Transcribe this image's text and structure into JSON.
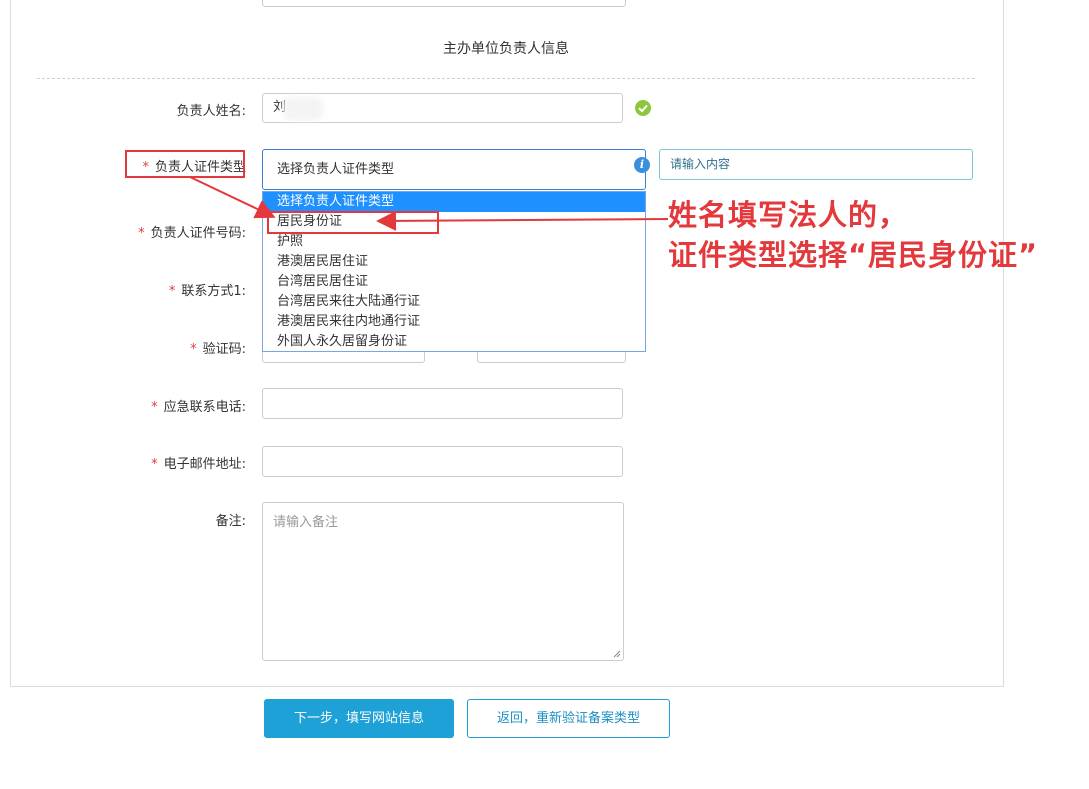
{
  "section": {
    "title": "主办单位负责人信息"
  },
  "form": {
    "name_label": "负责人姓名:",
    "name_value": "刘",
    "idtype_label": "负责人证件类型",
    "idtype_value": "选择负责人证件类型",
    "idtype_tooltip": "请输入内容",
    "idnum_label": "负责人证件号码:",
    "contact_label": "联系方式1:",
    "captcha_label": "验证码:",
    "emergency_label": "应急联系电话:",
    "email_label": "电子邮件地址:",
    "remark_label": "备注:",
    "remark_placeholder": "请输入备注",
    "required_mark": "*"
  },
  "dropdown": {
    "options": [
      "选择负责人证件类型",
      "居民身份证",
      "护照",
      "港澳居民居住证",
      "台湾居民居住证",
      "台湾居民来往大陆通行证",
      "港澳居民来往内地通行证",
      "外国人永久居留身份证"
    ],
    "selected_index": 0,
    "highlight_color": "#1e90ff"
  },
  "buttons": {
    "next": "下一步，填写网站信息",
    "back": "返回，重新验证备案类型"
  },
  "annotation": {
    "line1": "姓名填写法人的，",
    "line2": "证件类型选择“居民身份证”",
    "color": "#e4393c"
  },
  "icons": {
    "valid": "check-circle-icon",
    "info": "info-icon"
  }
}
